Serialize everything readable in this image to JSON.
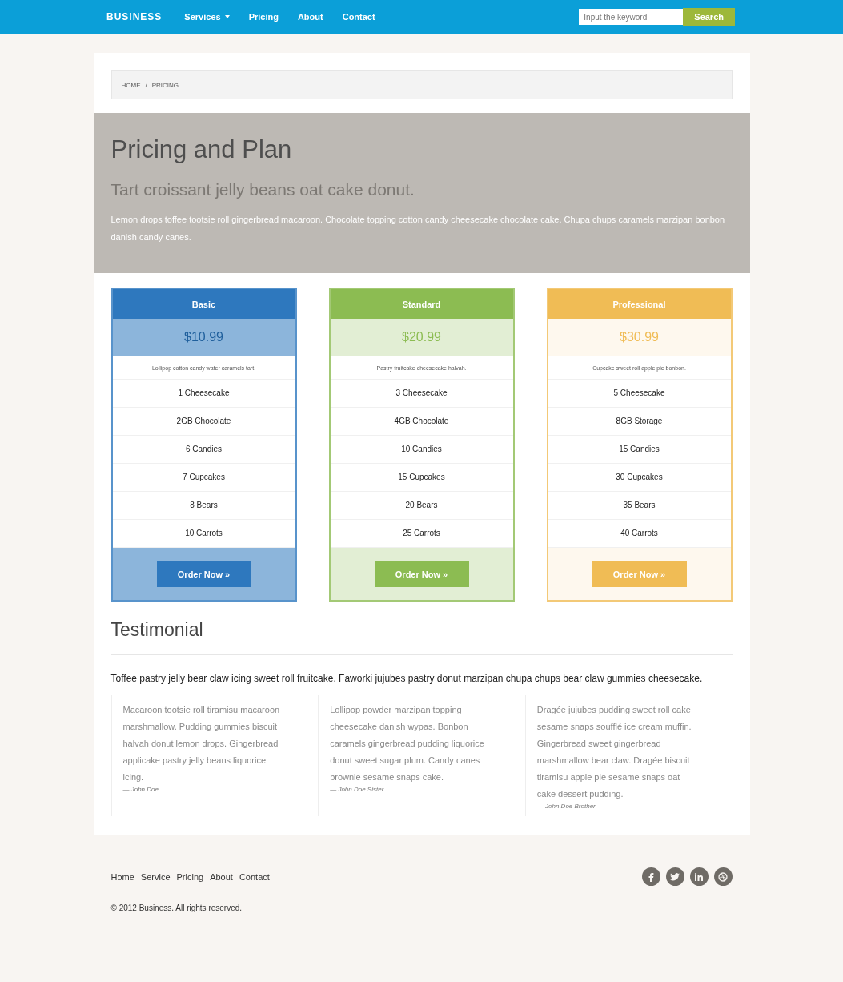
{
  "navbar": {
    "logo": "BUSINESS",
    "items": [
      {
        "label": "Services",
        "dropdown": true
      },
      {
        "label": "Pricing",
        "dropdown": false
      },
      {
        "label": "About",
        "dropdown": false
      },
      {
        "label": "Contact",
        "dropdown": false
      }
    ],
    "search": {
      "placeholder": "Input the keyword",
      "button": "Search"
    }
  },
  "breadcrumb": {
    "items": [
      "HOME",
      "PRICING"
    ],
    "separator": "/"
  },
  "hero": {
    "title": "Pricing and Plan",
    "subtitle": "Tart croissant jelly beans oat cake donut.",
    "text": "Lemon drops toffee tootsie roll gingerbread macaroon. Chocolate topping cotton candy cheesecake chocolate cake. Chupa chups caramels marzipan bonbon danish candy canes."
  },
  "plans": [
    {
      "name": "Basic",
      "color": "#2e78be",
      "price": "$10.99",
      "description": "Lollipop cotton candy wafer caramels tart.",
      "features": [
        "1 Cheesecake",
        "2GB Chocolate",
        "6 Candies",
        "7 Cupcakes",
        "8 Bears",
        "10 Carrots"
      ],
      "button": "Order Now »"
    },
    {
      "name": "Standard",
      "color": "#8cbc52",
      "price": "$20.99",
      "description": "Pastry fruitcake cheesecake halvah.",
      "features": [
        "3 Cheesecake",
        "4GB Chocolate",
        "10 Candies",
        "15 Cupcakes",
        "20 Bears",
        "25 Carrots"
      ],
      "button": "Order Now »"
    },
    {
      "name": "Professional",
      "color": "#f0bc55",
      "price": "$30.99",
      "description": "Cupcake sweet roll apple pie bonbon.",
      "features": [
        "5 Cheesecake",
        "8GB Storage",
        "15 Candies",
        "30 Cupcakes",
        "35 Bears",
        "40 Carrots"
      ],
      "button": "Order Now »"
    }
  ],
  "testimonial": {
    "title": "Testimonial",
    "intro": "Toffee pastry jelly bear claw icing sweet roll fruitcake. Faworki jujubes pastry donut marzipan chupa chups bear claw gummies cheesecake.",
    "quotes": [
      {
        "text": "Macaroon tootsie roll tiramisu macaroon marshmallow. Pudding gummies biscuit halvah donut lemon drops. Gingerbread applicake pastry jelly beans liquorice icing.",
        "author": "— John Doe"
      },
      {
        "text": "Lollipop powder marzipan topping cheesecake danish wypas. Bonbon caramels gingerbread pudding liquorice donut sweet sugar plum. Candy canes brownie sesame snaps cake.",
        "author": "— John Doe Sister"
      },
      {
        "text": "Dragée jujubes pudding sweet roll cake sesame snaps soufflé ice cream muffin. Gingerbread sweet gingerbread marshmallow bear claw. Dragée biscuit tiramisu apple pie sesame snaps oat cake dessert pudding.",
        "author": "— John Doe Brother"
      }
    ]
  },
  "footer": {
    "links": [
      "Home",
      "Service",
      "Pricing",
      "About",
      "Contact"
    ],
    "copyright": "© 2012 Business. All rights reserved."
  }
}
